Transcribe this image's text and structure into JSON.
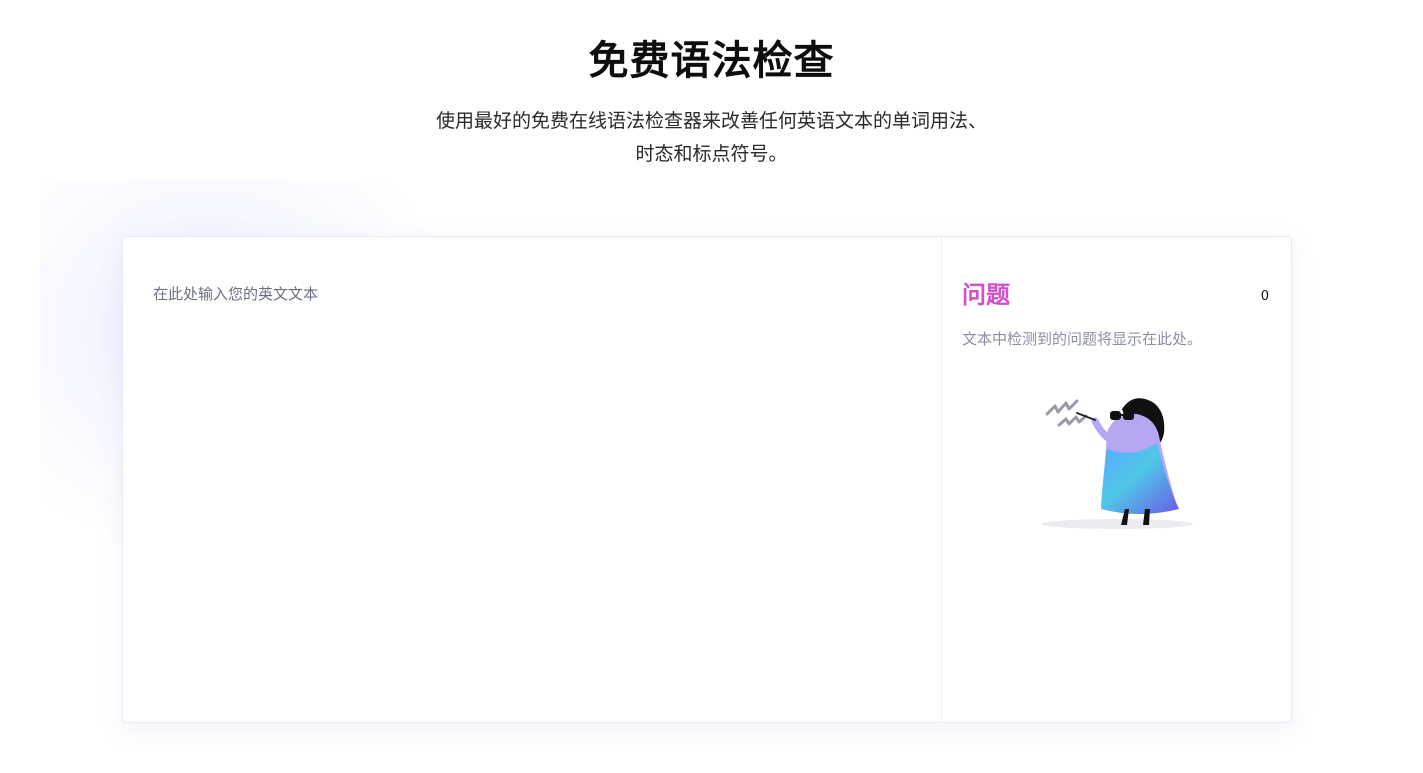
{
  "header": {
    "title": "免费语法检查",
    "subtitle_line1": "使用最好的免费在线语法检查器来改善任何英语文本的单词用法、",
    "subtitle_line2": "时态和标点符号。"
  },
  "editor": {
    "placeholder": "在此处输入您的英文文本",
    "value": ""
  },
  "issues": {
    "title": "问题",
    "count": "0",
    "description": "文本中检测到的问题将显示在此处。",
    "illustration_icon": "woman-with-sunglasses-illustration"
  },
  "colors": {
    "accent": "#d14fc8",
    "glow": "#aab9ff"
  }
}
